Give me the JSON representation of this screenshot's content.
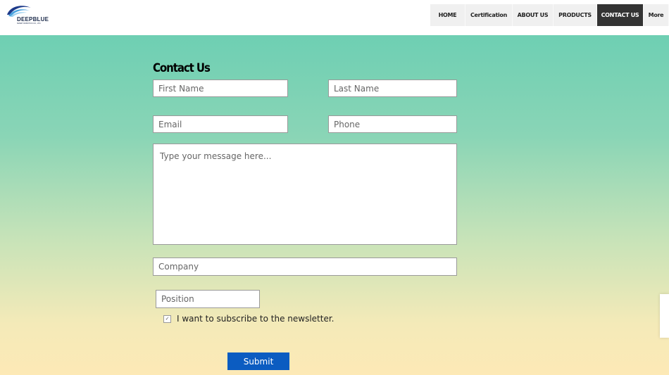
{
  "header": {
    "logo": {
      "name": "DEEPBLUE",
      "subtitle": "SMART ROBOTICS CO., LTD."
    },
    "nav": [
      {
        "label": "HOME",
        "active": false
      },
      {
        "label": "Certification",
        "active": false
      },
      {
        "label": "ABOUT US",
        "active": false
      },
      {
        "label": "PRODUCTS",
        "active": false
      },
      {
        "label": "CONTACT US",
        "active": true
      },
      {
        "label": "More",
        "active": false
      }
    ]
  },
  "form": {
    "title": "Contact Us",
    "first_name": {
      "value": "",
      "placeholder": "First Name"
    },
    "last_name": {
      "value": "",
      "placeholder": "Last Name"
    },
    "email": {
      "value": "",
      "placeholder": "Email"
    },
    "phone": {
      "value": "",
      "placeholder": "Phone"
    },
    "message": {
      "value": "",
      "placeholder": "Type your message here..."
    },
    "company": {
      "value": "",
      "placeholder": "Company"
    },
    "position": {
      "value": "",
      "placeholder": "Position"
    },
    "newsletter": {
      "label": "I want to subscribe to the newsletter.",
      "checked": true,
      "check_glyph": "✓"
    },
    "submit_label": "Submit"
  },
  "colors": {
    "accent": "#0b5cc1",
    "nav_active_bg": "#333333",
    "nav_bg": "#f0f0f0",
    "gradient_top": "#6ecfb3",
    "gradient_bottom": "#fde9b6"
  }
}
